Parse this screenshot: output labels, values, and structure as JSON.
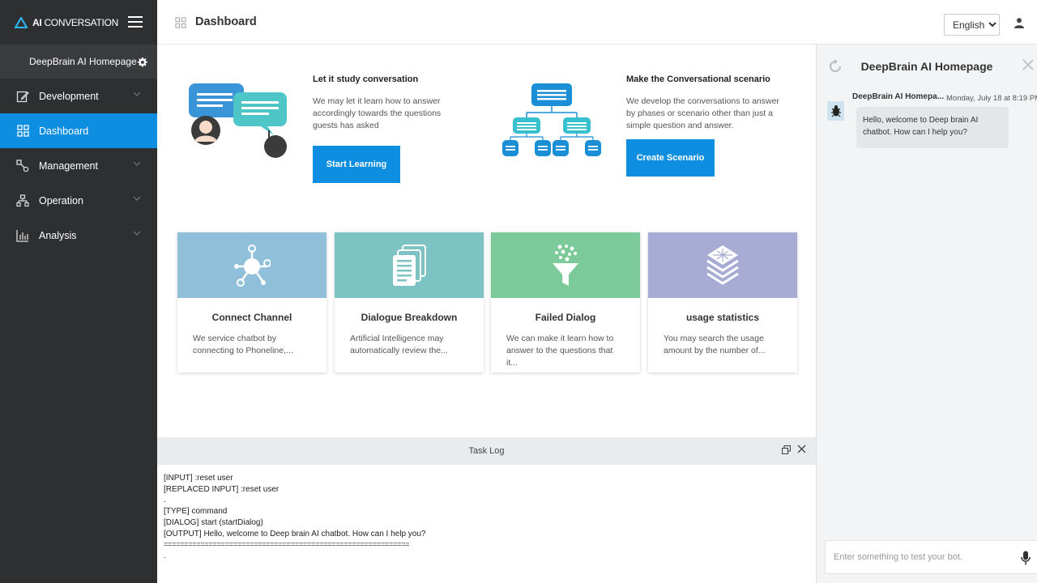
{
  "brand": {
    "bold": "AI",
    "rest": " CONVERSATION"
  },
  "project": {
    "name": "DeepBrain AI Homepage"
  },
  "sidebar": {
    "items": [
      {
        "label": "Development"
      },
      {
        "label": "Dashboard"
      },
      {
        "label": "Management"
      },
      {
        "label": "Operation"
      },
      {
        "label": "Analysis"
      }
    ]
  },
  "header": {
    "title": "Dashboard",
    "language": "English"
  },
  "promos": [
    {
      "title": "Let it study conversation",
      "desc": "We may let it learn how to answer accordingly towards the questions guests has asked",
      "button": "Start Learning"
    },
    {
      "title": "Make the Conversational scenario",
      "desc": "We develop the conversations to answer by phases or scenario other than just a simple question and answer.",
      "button": "Create Scenario"
    }
  ],
  "cards": [
    {
      "title": "Connect Channel",
      "desc": "We service chatbot by connecting to Phoneline,...",
      "color": "#8fbfd9"
    },
    {
      "title": "Dialogue Breakdown",
      "desc": "Artificial Intelligence may automatically review the...",
      "color": "#7ec3c4"
    },
    {
      "title": "Failed Dialog",
      "desc": "We can make it learn how to answer to the questions that it...",
      "color": "#7cc99a"
    },
    {
      "title": "usage statistics",
      "desc": "You may search the usage amount by the number of...",
      "color": "#a8acd4"
    }
  ],
  "tasklog": {
    "title": "Task Log",
    "lines": [
      "[INPUT] :reset user",
      "[REPLACED INPUT] :reset user",
      ".",
      "[TYPE] command",
      "[DIALOG] start (startDialog)",
      "[OUTPUT] Hello, welcome to Deep brain AI chatbot. How can I help you?",
      "============================================================",
      "."
    ]
  },
  "chat": {
    "title": "DeepBrain AI Homepage",
    "sender": "DeepBrain AI Homepa...",
    "time": "Monday, July 18 at 8:19 PM",
    "message": "Hello, welcome to Deep brain AI chatbot. How can I help you?",
    "placeholder": "Enter something to test your bot."
  },
  "colors": {
    "sidebar": "#2e2f31",
    "accent": "#0d8ee0",
    "chatbg": "#f3f4f5"
  }
}
